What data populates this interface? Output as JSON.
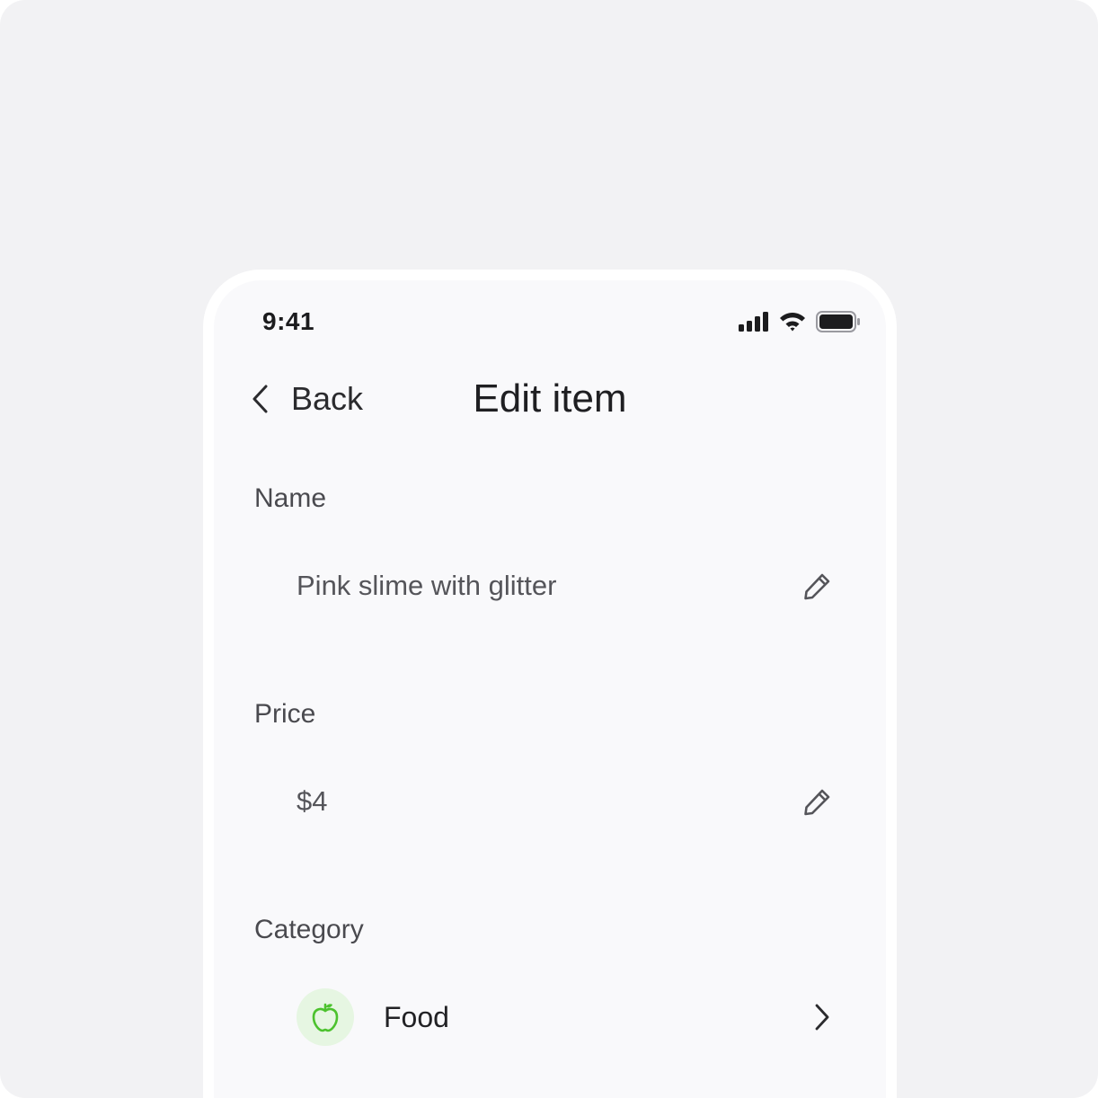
{
  "status_bar": {
    "time": "9:41",
    "icons": [
      "cellular-signal-icon",
      "wifi-icon",
      "battery-icon"
    ]
  },
  "nav": {
    "back_label": "Back",
    "back_icon": "chevron-left-icon",
    "title": "Edit item"
  },
  "fields": {
    "name": {
      "label": "Name",
      "value": "Pink slime with glitter",
      "action_icon": "pencil-icon"
    },
    "price": {
      "label": "Price",
      "value": "$4",
      "action_icon": "pencil-icon"
    },
    "category": {
      "label": "Category",
      "value": "Food",
      "icon": "apple-icon",
      "action_icon": "chevron-right-icon"
    }
  },
  "colors": {
    "background": "#f2f2f4",
    "screen": "#f9f9fb",
    "category_badge": "#e6f6e2",
    "category_icon": "#4cc22e",
    "text_primary": "#1f1f22",
    "text_secondary": "#55555a"
  }
}
